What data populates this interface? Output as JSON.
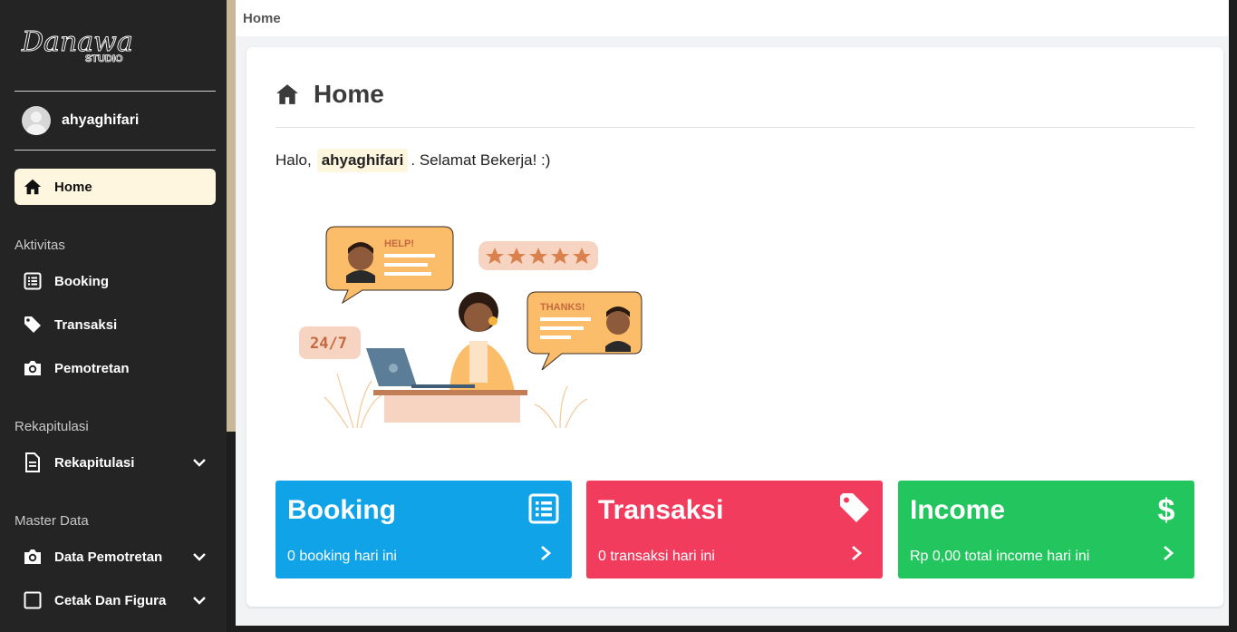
{
  "brand": {
    "script_text": "Danawa",
    "sub_text": "STUDIO"
  },
  "user": {
    "name": "ahyaghifari"
  },
  "nav": {
    "home": "Home",
    "section_aktivitas": "Aktivitas",
    "booking": "Booking",
    "transaksi": "Transaksi",
    "pemotretan": "Pemotretan",
    "section_rekap": "Rekapitulasi",
    "rekapitulasi": "Rekapitulasi",
    "section_master": "Master Data",
    "data_pemotretan": "Data Pemotretan",
    "cetak_figura": "Cetak Dan Figura"
  },
  "breadcrumb": "Home",
  "page": {
    "title": "Home",
    "greeting_prefix": "Halo,",
    "greeting_name": "ahyaghifari",
    "greeting_suffix": ". Selamat Bekerja! :)"
  },
  "illustration": {
    "help_label": "HELP!",
    "thanks_label": "THANKS!",
    "hours_label": "24/7"
  },
  "stats": {
    "booking": {
      "title": "Booking",
      "subtitle": "0 booking hari ini",
      "color": "#10a3e8"
    },
    "transaksi": {
      "title": "Transaksi",
      "subtitle": "0 transaksi hari ini",
      "color": "#f23c5e"
    },
    "income": {
      "title": "Income",
      "subtitle": "Rp 0,00 total income hari ini",
      "color": "#22c55e"
    }
  },
  "colors": {
    "sidebar": "#242424",
    "active_item": "#fff6e0",
    "accent_tan": "#c9b79a"
  }
}
